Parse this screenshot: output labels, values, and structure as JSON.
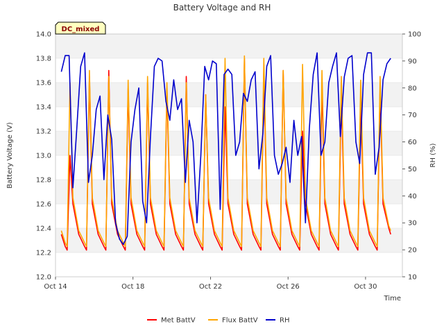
{
  "chart_data": {
    "type": "line",
    "title": "Battery Voltage and RH",
    "xlabel": "Time",
    "ylabel": "Battery Voltage (V)",
    "y2label": "RH (%)",
    "badge": "DC_mixed",
    "xlim": [
      14.0,
      31.9
    ],
    "ylim": [
      12.0,
      14.0
    ],
    "y2lim": [
      10,
      100
    ],
    "x_ticks": [
      {
        "value": 14,
        "label": "Oct 14"
      },
      {
        "value": 18,
        "label": "Oct 18"
      },
      {
        "value": 22,
        "label": "Oct 22"
      },
      {
        "value": 26,
        "label": "Oct 26"
      },
      {
        "value": 30,
        "label": "Oct 30"
      }
    ],
    "y_ticks": [
      "12.0",
      "12.2",
      "12.4",
      "12.6",
      "12.8",
      "13.0",
      "13.2",
      "13.4",
      "13.6",
      "13.8",
      "14.0"
    ],
    "y2_ticks": [
      "10",
      "20",
      "30",
      "40",
      "50",
      "60",
      "70",
      "80",
      "90",
      "100"
    ],
    "grid": true,
    "legend_position": "bottom",
    "series": [
      {
        "name": "Met BattV",
        "axis": "left",
        "color": "#ff0000",
        "x": [
          14.3,
          14.5,
          14.6,
          14.75,
          14.9,
          15.2,
          15.5,
          15.6,
          15.75,
          15.9,
          16.2,
          16.5,
          16.6,
          16.75,
          16.9,
          17.2,
          17.5,
          17.6,
          17.75,
          17.9,
          18.2,
          18.5,
          18.6,
          18.75,
          18.9,
          19.2,
          19.5,
          19.6,
          19.75,
          19.9,
          20.2,
          20.5,
          20.6,
          20.75,
          20.9,
          21.2,
          21.5,
          21.6,
          21.75,
          21.9,
          22.2,
          22.5,
          22.6,
          22.75,
          22.9,
          23.2,
          23.5,
          23.6,
          23.75,
          23.9,
          24.2,
          24.5,
          24.6,
          24.75,
          24.9,
          25.2,
          25.5,
          25.6,
          25.75,
          25.9,
          26.2,
          26.5,
          26.6,
          26.75,
          26.9,
          27.2,
          27.5,
          27.6,
          27.75,
          27.9,
          28.2,
          28.5,
          28.6,
          28.75,
          28.9,
          29.2,
          29.5,
          29.6,
          29.75,
          29.9,
          30.2,
          30.5,
          30.6,
          30.75,
          30.9,
          31.2,
          31.3
        ],
        "y": [
          12.35,
          12.25,
          12.22,
          13.0,
          12.6,
          12.35,
          12.25,
          12.22,
          13.65,
          12.6,
          12.35,
          12.25,
          12.22,
          13.7,
          12.6,
          12.35,
          12.25,
          12.22,
          13.55,
          12.6,
          12.35,
          12.25,
          12.22,
          13.6,
          12.6,
          12.35,
          12.25,
          12.22,
          13.55,
          12.6,
          12.35,
          12.25,
          12.22,
          13.65,
          12.6,
          12.35,
          12.25,
          12.22,
          13.5,
          12.6,
          12.35,
          12.25,
          12.22,
          13.4,
          12.6,
          12.35,
          12.25,
          12.22,
          13.8,
          12.6,
          12.35,
          12.25,
          12.22,
          13.7,
          12.6,
          12.35,
          12.25,
          12.22,
          13.7,
          12.6,
          12.35,
          12.25,
          12.22,
          13.2,
          12.6,
          12.35,
          12.25,
          12.22,
          13.55,
          12.6,
          12.35,
          12.25,
          12.22,
          13.5,
          12.6,
          12.35,
          12.25,
          12.22,
          13.45,
          12.6,
          12.35,
          12.25,
          12.22,
          13.55,
          12.6,
          12.4,
          12.35
        ]
      },
      {
        "name": "Flux BattV",
        "axis": "left",
        "color": "#ffa500",
        "x": [
          14.3,
          14.5,
          14.6,
          14.75,
          14.9,
          15.2,
          15.5,
          15.6,
          15.75,
          15.9,
          16.2,
          16.5,
          16.6,
          16.75,
          16.9,
          17.2,
          17.5,
          17.6,
          17.75,
          17.9,
          18.2,
          18.5,
          18.6,
          18.75,
          18.9,
          19.2,
          19.5,
          19.6,
          19.75,
          19.9,
          20.2,
          20.5,
          20.6,
          20.75,
          20.9,
          21.2,
          21.5,
          21.6,
          21.75,
          21.9,
          22.2,
          22.5,
          22.6,
          22.75,
          22.9,
          23.2,
          23.5,
          23.6,
          23.75,
          23.9,
          24.2,
          24.5,
          24.6,
          24.75,
          24.9,
          25.2,
          25.5,
          25.6,
          25.75,
          25.9,
          26.2,
          26.5,
          26.6,
          26.75,
          26.9,
          27.2,
          27.5,
          27.6,
          27.75,
          27.9,
          28.2,
          28.5,
          28.6,
          28.75,
          28.9,
          29.2,
          29.5,
          29.6,
          29.75,
          29.9,
          30.2,
          30.5,
          30.6,
          30.75,
          30.9,
          31.2,
          31.3
        ],
        "y": [
          12.38,
          12.28,
          12.25,
          13.6,
          12.65,
          12.38,
          12.28,
          12.25,
          13.7,
          12.65,
          12.38,
          12.28,
          12.25,
          13.65,
          12.65,
          12.38,
          12.28,
          12.25,
          13.62,
          12.65,
          12.38,
          12.28,
          12.25,
          13.65,
          12.65,
          12.38,
          12.28,
          12.25,
          13.6,
          12.65,
          12.38,
          12.28,
          12.25,
          13.6,
          12.65,
          12.38,
          12.28,
          12.25,
          13.5,
          12.65,
          12.38,
          12.28,
          12.25,
          13.8,
          12.65,
          12.38,
          12.28,
          12.25,
          13.82,
          12.65,
          12.38,
          12.28,
          12.25,
          13.8,
          12.65,
          12.38,
          12.28,
          12.25,
          13.7,
          12.65,
          12.38,
          12.28,
          12.25,
          13.75,
          12.65,
          12.38,
          12.28,
          12.25,
          13.7,
          12.65,
          12.38,
          12.28,
          12.25,
          13.65,
          12.65,
          12.38,
          12.28,
          12.25,
          13.62,
          12.65,
          12.38,
          12.28,
          12.25,
          13.65,
          12.65,
          12.42,
          12.38
        ]
      },
      {
        "name": "RH",
        "axis": "right",
        "color": "#0000cc",
        "x": [
          14.3,
          14.5,
          14.7,
          14.9,
          15.1,
          15.3,
          15.5,
          15.7,
          15.9,
          16.1,
          16.3,
          16.5,
          16.7,
          16.9,
          17.1,
          17.3,
          17.5,
          17.7,
          17.9,
          18.1,
          18.3,
          18.5,
          18.7,
          18.9,
          19.1,
          19.3,
          19.5,
          19.7,
          19.9,
          20.1,
          20.3,
          20.5,
          20.7,
          20.9,
          21.1,
          21.3,
          21.5,
          21.7,
          21.9,
          22.1,
          22.3,
          22.5,
          22.7,
          22.9,
          23.1,
          23.3,
          23.5,
          23.7,
          23.9,
          24.1,
          24.3,
          24.5,
          24.7,
          24.9,
          25.1,
          25.3,
          25.5,
          25.7,
          25.9,
          26.1,
          26.3,
          26.5,
          26.7,
          26.9,
          27.1,
          27.3,
          27.5,
          27.7,
          27.9,
          28.1,
          28.3,
          28.5,
          28.7,
          28.9,
          29.1,
          29.3,
          29.5,
          29.7,
          29.9,
          30.1,
          30.3,
          30.5,
          30.7,
          30.9,
          31.1,
          31.3
        ],
        "y": [
          86,
          92,
          92,
          43,
          65,
          88,
          93,
          45,
          55,
          72,
          77,
          46,
          70,
          61,
          30,
          24,
          22,
          25,
          60,
          72,
          80,
          38,
          30,
          62,
          88,
          91,
          90,
          75,
          68,
          83,
          72,
          76,
          45,
          68,
          60,
          30,
          55,
          88,
          83,
          90,
          89,
          35,
          85,
          87,
          85,
          55,
          60,
          78,
          75,
          83,
          86,
          50,
          63,
          88,
          92,
          55,
          48,
          52,
          58,
          45,
          68,
          55,
          62,
          30,
          65,
          85,
          93,
          55,
          60,
          82,
          88,
          93,
          62,
          84,
          91,
          92,
          60,
          52,
          85,
          93,
          93,
          48,
          58,
          83,
          89,
          91
        ]
      }
    ]
  }
}
